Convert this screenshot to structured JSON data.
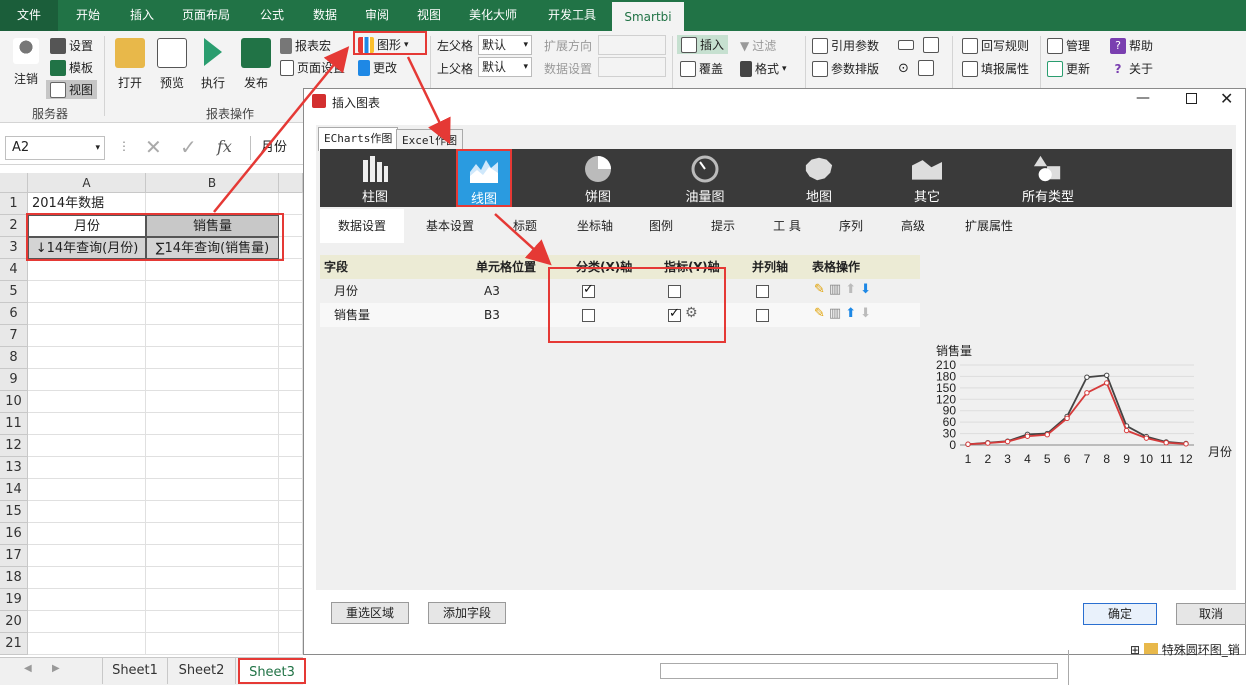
{
  "ribbon_tabs": [
    {
      "label": "文件"
    },
    {
      "label": "开始"
    },
    {
      "label": "插入"
    },
    {
      "label": "页面布局"
    },
    {
      "label": "公式"
    },
    {
      "label": "数据"
    },
    {
      "label": "审阅"
    },
    {
      "label": "视图"
    },
    {
      "label": "美化大师"
    },
    {
      "label": "开发工具"
    },
    {
      "label": "Smartbi"
    }
  ],
  "ribbon": {
    "server": {
      "logout": "注销",
      "settings": "设置",
      "template": "模板",
      "view": "视图",
      "group": "服务器"
    },
    "report": {
      "open": "打开",
      "preview": "预览",
      "execute": "执行",
      "publish": "发布",
      "macro": "报表宏",
      "page_setup": "页面设置",
      "chart": "图形",
      "change": "更改",
      "group": "报表操作"
    },
    "parent": {
      "left_label": "左父格",
      "left_value": "默认",
      "top_label": "上父格",
      "top_value": "默认"
    },
    "expand": {
      "direction": "扩展方向",
      "data_settings": "数据设置"
    },
    "insert": {
      "insert": "插入",
      "overwrite": "覆盖",
      "filter": "过滤",
      "format": "格式"
    },
    "params": {
      "ref": "引用参数",
      "layout": "参数排版"
    },
    "writeback": {
      "rule": "回写规则",
      "fill": "填报属性"
    },
    "manage": {
      "manage": "管理",
      "update": "更新",
      "help": "帮助",
      "about": "关于"
    }
  },
  "formula_bar": {
    "cell_ref": "A2",
    "fx": "fx",
    "value": "月份"
  },
  "sheet": {
    "columns": [
      "A",
      "B"
    ],
    "rows": [
      "1",
      "2",
      "3",
      "4",
      "5",
      "6",
      "7",
      "8",
      "9",
      "10",
      "11",
      "12",
      "13",
      "14",
      "15",
      "16",
      "17",
      "18",
      "19",
      "20",
      "21"
    ],
    "a1": "2014年数据",
    "a2": "月份",
    "b2": "销售量",
    "a3": "↓14年查询(月份)",
    "b3": "∑14年查询(销售量)"
  },
  "sheet_tabs": [
    {
      "label": "Sheet1"
    },
    {
      "label": "Sheet2"
    },
    {
      "label": "Sheet3"
    }
  ],
  "dialog": {
    "title": "插入图表",
    "chart_tabs": [
      "ECharts作图",
      "Excel作图"
    ],
    "types": [
      {
        "label": "柱图",
        "icon": "bar-chart-icon"
      },
      {
        "label": "线图",
        "icon": "line-chart-icon"
      },
      {
        "label": "饼图",
        "icon": "pie-chart-icon"
      },
      {
        "label": "油量图",
        "icon": "gauge-icon"
      },
      {
        "label": "地图",
        "icon": "map-icon"
      },
      {
        "label": "其它",
        "icon": "other-chart-icon"
      },
      {
        "label": "所有类型",
        "icon": "all-types-icon"
      }
    ],
    "settings_tabs": [
      "数据设置",
      "基本设置",
      "标题",
      "坐标轴",
      "图例",
      "提示",
      "工 具",
      "序列",
      "高级",
      "扩展属性"
    ],
    "grid_headers": [
      "字段",
      "单元格位置",
      "分类(X)轴",
      "指标(Y)轴",
      "并列轴",
      "表格操作"
    ],
    "rows": [
      {
        "field": "月份",
        "cell": "A3",
        "x": true,
        "y": false,
        "parallel": false
      },
      {
        "field": "销售量",
        "cell": "B3",
        "x": false,
        "y": true,
        "parallel": false
      }
    ],
    "buttons": {
      "reselect": "重选区域",
      "add_field": "添加字段",
      "ok": "确定",
      "cancel": "取消"
    }
  },
  "chart_data": {
    "type": "line",
    "ylabel": "销售量",
    "xlabel": "月份",
    "x": [
      1,
      2,
      3,
      4,
      5,
      6,
      7,
      8,
      9,
      10,
      11,
      12
    ],
    "ylim": [
      0,
      210
    ],
    "yticks": [
      0,
      30,
      60,
      90,
      120,
      150,
      180,
      210
    ],
    "series": [
      {
        "values": [
          2,
          6,
          10,
          28,
          30,
          75,
          178,
          183,
          50,
          22,
          8,
          4
        ],
        "color": "#444444"
      },
      {
        "values": [
          2,
          5,
          9,
          23,
          27,
          70,
          137,
          163,
          38,
          18,
          6,
          3
        ],
        "color": "#d63b3b"
      }
    ]
  },
  "tree_peek": "特殊圆环图_销",
  "colors": {
    "accent": "#217346",
    "highlight": "#2a9be0",
    "annotation": "#e53935"
  }
}
